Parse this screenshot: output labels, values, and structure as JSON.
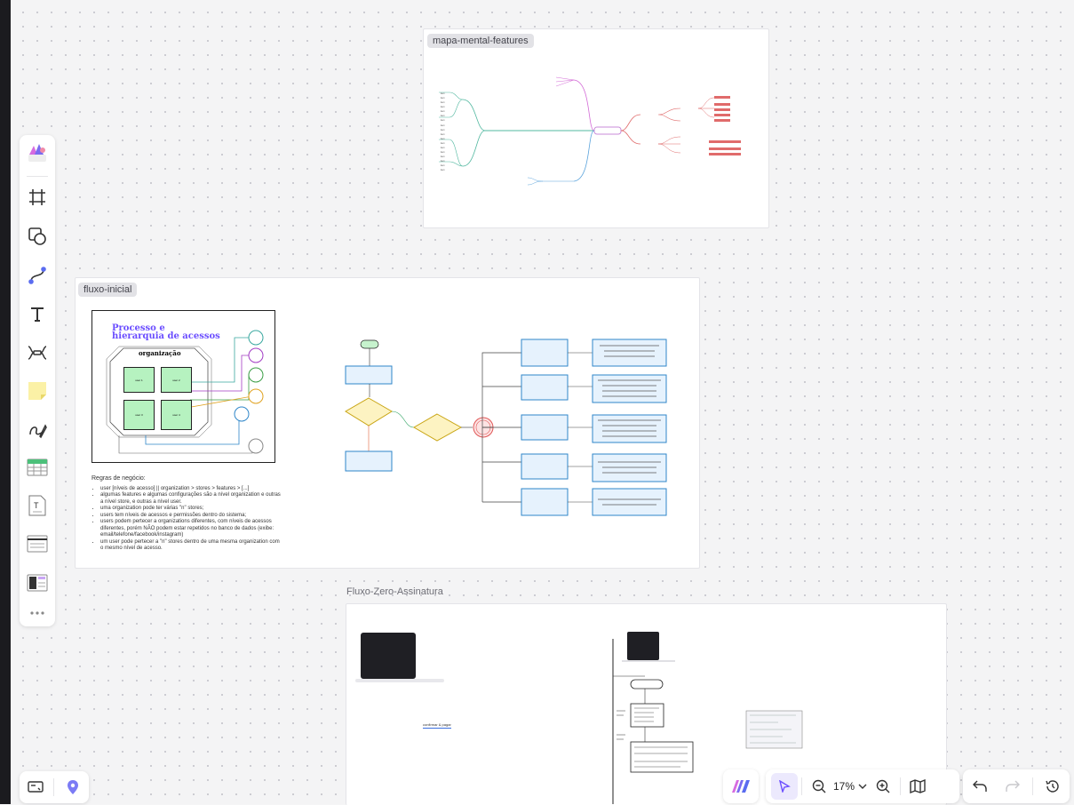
{
  "frames": {
    "mind_map": {
      "label": "mapa-mental-features"
    },
    "initial_flow": {
      "label": "fluxo-inicial"
    },
    "zero_flow": {
      "label": "Fluxo-Zero-Assinatura"
    }
  },
  "hierarchy_card": {
    "title_line1": "Processo e",
    "title_line2": "hierarquia de acessos",
    "org_label": "organização",
    "stores": [
      "user 1",
      "user 2",
      "user 3",
      "user 4"
    ]
  },
  "business_rules": {
    "heading": "Regras de negócio:",
    "items": [
      "user [níveis de acesso] || organization > stores > features > [...]",
      "algumas features e algumas configurações são a nível organization e outras a nível store, e outras a nível user.",
      "uma organization pode ter várias \"n\" stores;",
      "users tem níveis de acessos e permissões dentro do sistema;",
      "users podem pertecer a organizations diferentes, com níveis de acessos diferentes, porém NÃO podem estar repetidos no banco de dados (exibe: email/telefone/facebook/instagram)",
      "um user pode pertecer a \"n\" stores dentro de uma mesma organization com o mesmo nível de acesso."
    ]
  },
  "zero_flow": {
    "caption": "confirmar & pagar"
  },
  "bottom_right": {
    "zoom": "17%"
  },
  "icons": {
    "toolbar": [
      "logo-icon",
      "frame-icon",
      "shape-icon",
      "connector-icon",
      "text-icon",
      "mindmap-icon",
      "sticky-note-icon",
      "pen-icon",
      "table-icon",
      "document-icon",
      "list-icon",
      "template-icon",
      "more-icon"
    ],
    "bottom_left": [
      "present-icon",
      "location-icon"
    ],
    "bottom_right": [
      "affine-icon",
      "pointer-icon",
      "zoom-out-icon",
      "chevron-down-icon",
      "zoom-in-icon",
      "map-icon",
      "undo-icon",
      "redo-icon",
      "history-icon"
    ]
  },
  "colors": {
    "accent": "#6b4eff",
    "toolbar_bg": "#ffffff",
    "canvas_bg": "#f4f4f5"
  }
}
